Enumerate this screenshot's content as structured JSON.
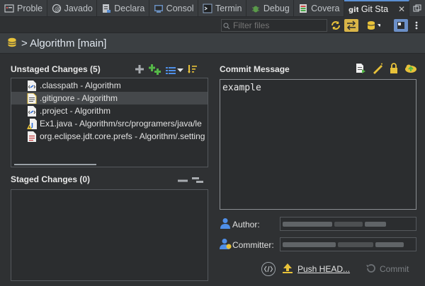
{
  "tabs": [
    {
      "label": "Proble",
      "icon": "problems-icon"
    },
    {
      "label": "Javado",
      "icon": "javadoc-icon"
    },
    {
      "label": "Declara",
      "icon": "declaration-icon"
    },
    {
      "label": "Consol",
      "icon": "console-icon"
    },
    {
      "label": "Termin",
      "icon": "terminal-icon"
    },
    {
      "label": "Debug",
      "icon": "debug-icon"
    },
    {
      "label": "Covera",
      "icon": "coverage-icon"
    },
    {
      "label": "Git Sta",
      "icon": "git-icon",
      "active": true,
      "icon_text": "git"
    }
  ],
  "toolbar": {
    "filter_placeholder": "Filter files"
  },
  "repo": {
    "title": "> Algorithm [main]"
  },
  "unstaged": {
    "title": "Unstaged Changes (5)",
    "items": [
      {
        "label": ".classpath - Algorithm",
        "icon": "xml-file-icon"
      },
      {
        "label": ".gitignore - Algorithm",
        "icon": "text-file-icon",
        "selected": true
      },
      {
        "label": ".project - Algorithm",
        "icon": "xml-file-icon"
      },
      {
        "label": "Ex1.java - Algorithm/src/programers/java/le",
        "icon": "java-file-warning-icon"
      },
      {
        "label": "org.eclipse.jdt.core.prefs - Algorithm/.setting",
        "icon": "prefs-file-icon"
      }
    ]
  },
  "staged": {
    "title": "Staged Changes (0)"
  },
  "commit": {
    "title": "Commit Message",
    "message": "example",
    "author_label": "Author:",
    "committer_label": "Committer:",
    "push_label": "Push HEAD...",
    "commit_label": "Commit"
  },
  "colors": {
    "accent_yellow": "#e8c23a",
    "accent_green": "#55b848",
    "accent_blue": "#4f8fe8",
    "selected_row": "#45484b"
  }
}
